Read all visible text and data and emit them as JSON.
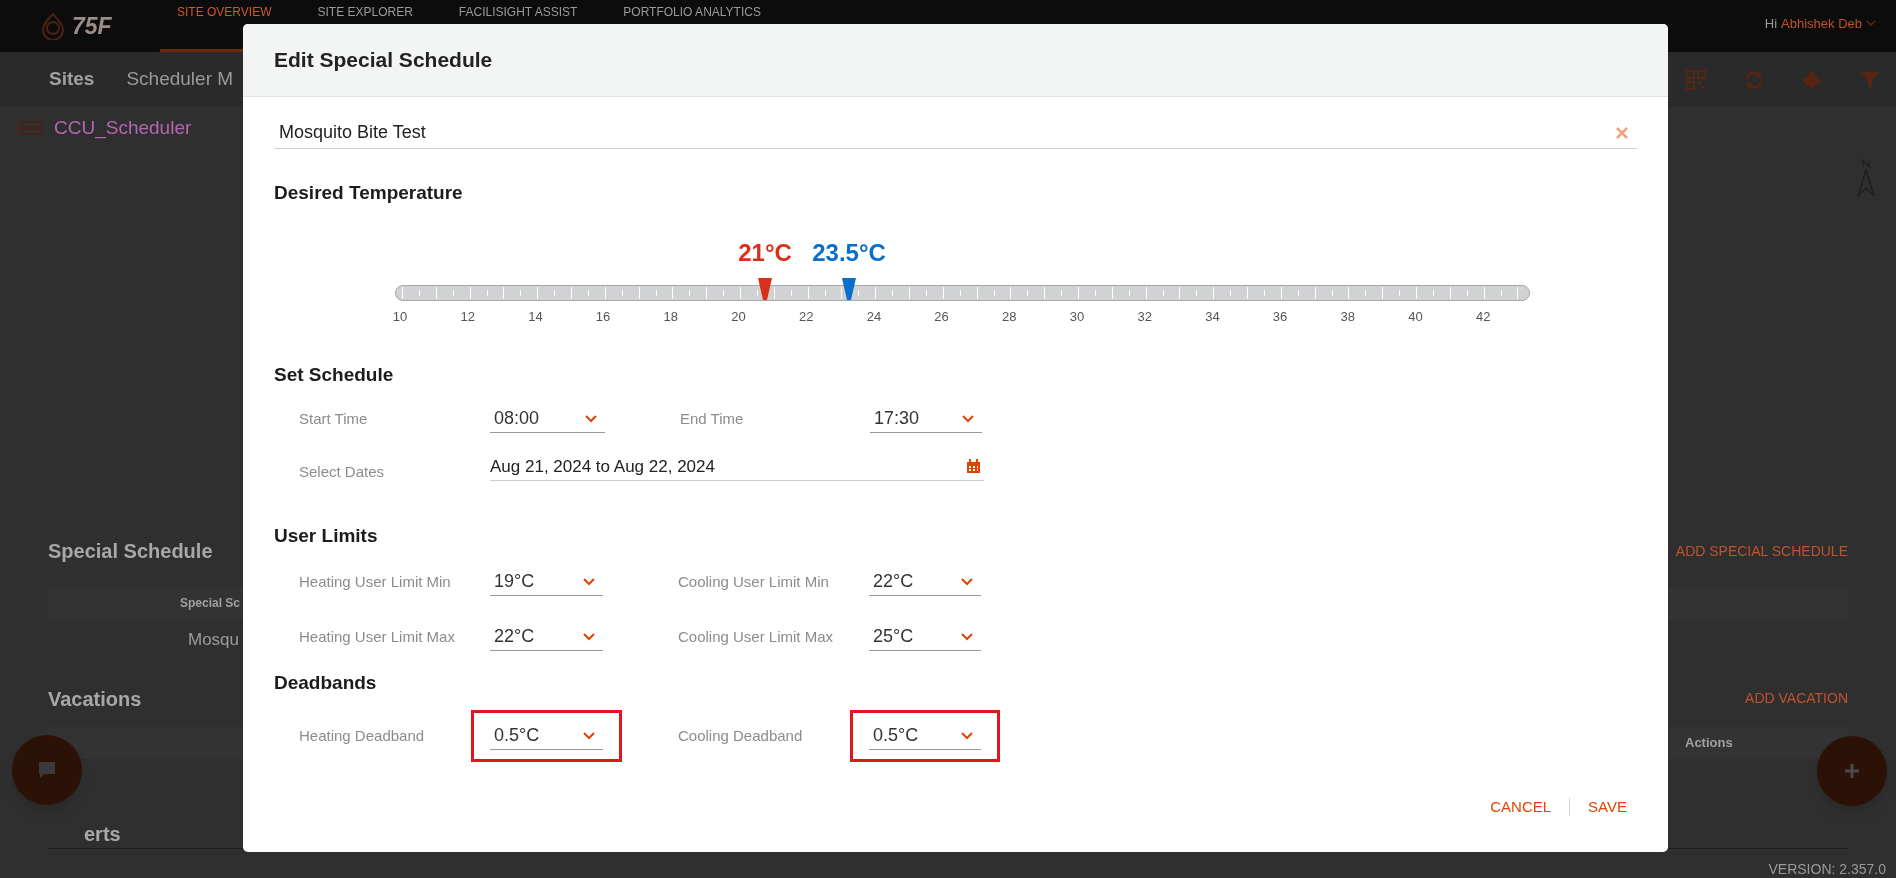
{
  "top_bar": {
    "logo": "75F",
    "nav": [
      {
        "label": "SITE OVERVIEW",
        "selected": true
      },
      {
        "label": "SITE EXPLORER",
        "selected": false
      },
      {
        "label": "FACILISIGHT ASSIST",
        "selected": false
      },
      {
        "label": "PORTFOLIO ANALYTICS",
        "selected": false
      }
    ],
    "greeting": "Hi",
    "user": "Abhishek Deb"
  },
  "sub_bar": {
    "title": "Sites",
    "tab": "Scheduler M"
  },
  "breadcrumb": "CCU_Scheduler",
  "special_schedule": {
    "title": "Special Schedule",
    "action": "ADD SPECIAL SCHEDULE",
    "column": "Special Sc",
    "row": "Mosqu"
  },
  "vacations": {
    "title": "Vacations",
    "action": "ADD VACATION",
    "column": "Actions"
  },
  "alerts": {
    "title": "erts"
  },
  "version": "VERSION: 2.357.0",
  "modal": {
    "title": "Edit Special Schedule",
    "name": "Mosquito Bite Test",
    "temperature": {
      "title": "Desired Temperature",
      "scale": [
        "10",
        "12",
        "14",
        "16",
        "18",
        "20",
        "22",
        "24",
        "26",
        "28",
        "30",
        "32",
        "34",
        "36",
        "38",
        "40",
        "42"
      ],
      "heating": {
        "reading": "21°C",
        "level": 0.326
      },
      "cooling": {
        "reading": "23.5°C",
        "level": 0.4
      }
    },
    "schedule": {
      "title": "Set Schedule",
      "start": {
        "label": "Start Time",
        "value": "08:00"
      },
      "end": {
        "label": "End Time",
        "value": "17:30"
      },
      "dates": {
        "label": "Select Dates",
        "value": "Aug 21, 2024 to Aug 22, 2024"
      }
    },
    "user_limits": {
      "title": "User Limits",
      "fields": [
        {
          "label": "Heating User Limit Min",
          "value": "19°C",
          "highlighted": false
        },
        {
          "label": "Cooling User Limit Min",
          "value": "22°C",
          "highlighted": false
        },
        {
          "label": "Heating User Limit Max",
          "value": "22°C",
          "highlighted": false
        },
        {
          "label": "Cooling User Limit Max",
          "value": "25°C",
          "highlighted": false
        }
      ]
    },
    "deadbands": {
      "title": "Deadbands",
      "fields": [
        {
          "label": "Heating Deadband",
          "value": "0.5°C",
          "highlighted": true
        },
        {
          "label": "Cooling Deadband",
          "value": "0.5°C",
          "highlighted": true
        }
      ]
    },
    "buttons": [
      "CANCEL",
      "SAVE"
    ]
  }
}
